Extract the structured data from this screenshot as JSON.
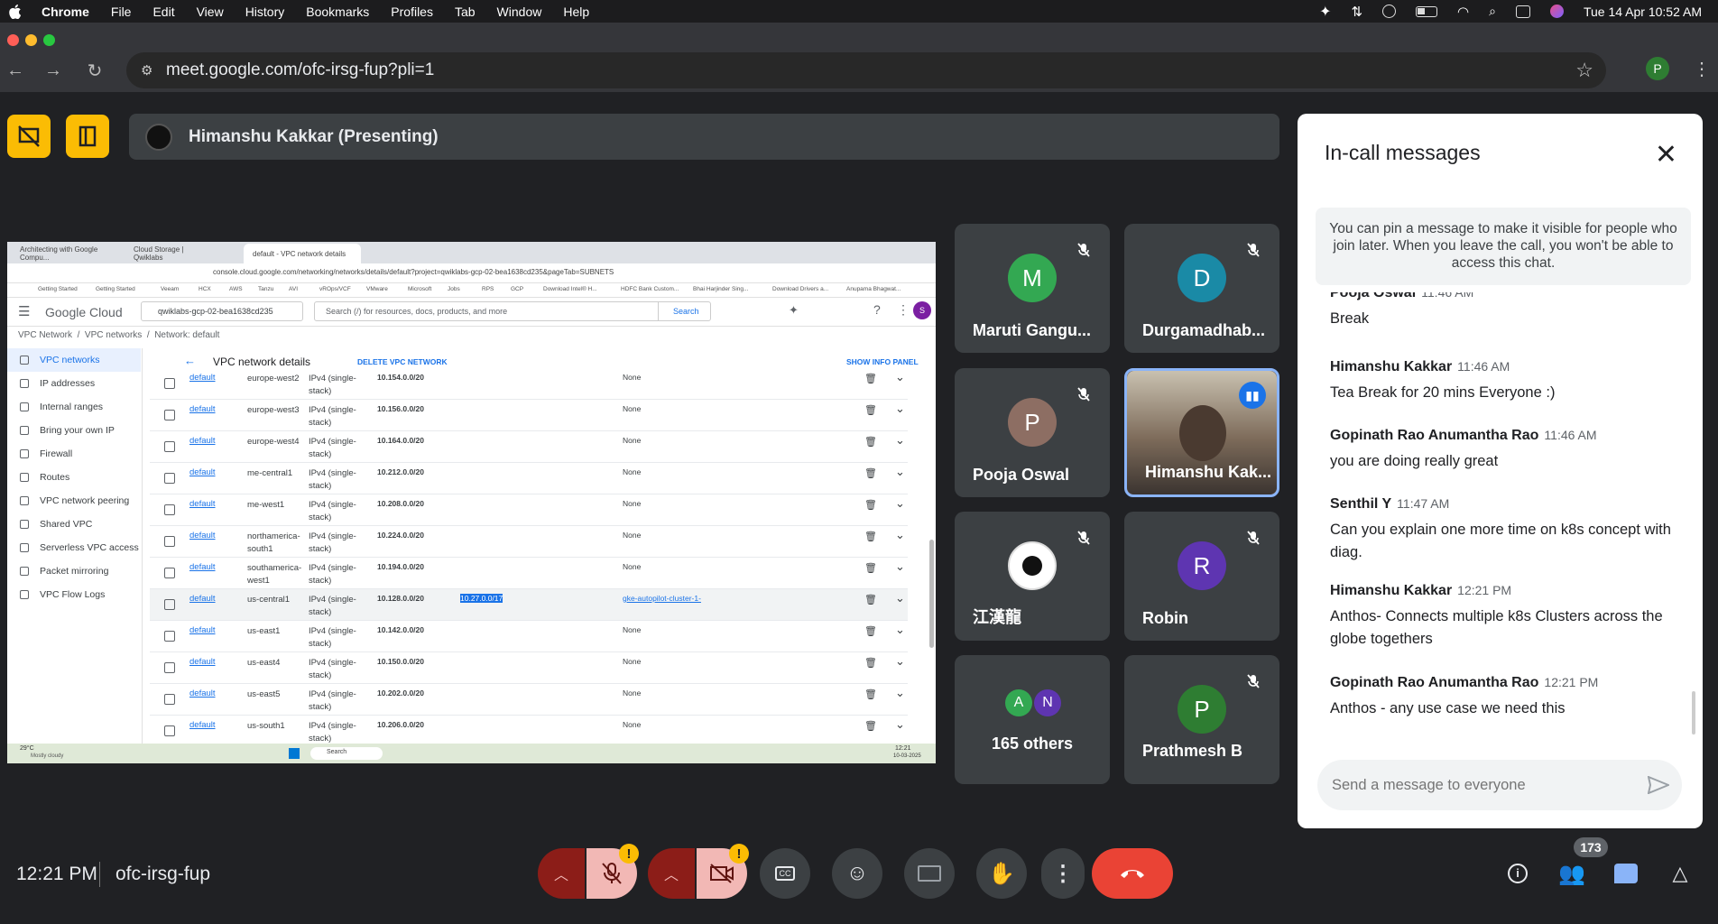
{
  "menubar": {
    "app": "Chrome",
    "items": [
      "File",
      "Edit",
      "View",
      "History",
      "Bookmarks",
      "Profiles",
      "Tab",
      "Window",
      "Help"
    ],
    "datetime": "Tue 14 Apr  10:52 AM"
  },
  "browser": {
    "url": "meet.google.com/ofc-irsg-fup?pli=1",
    "profile_initial": "P"
  },
  "presenting": {
    "label": "Himanshu Kakkar (Presenting)"
  },
  "shared_screen": {
    "tabs": [
      "Architecting with Google Compu...",
      "Cloud Storage | Qwiklabs",
      "default - VPC network details"
    ],
    "url": "console.cloud.google.com/networking/networks/details/default?project=qwiklabs-gcp-02-bea1638cd235&pageTab=SUBNETS",
    "bookmarks": [
      "Getting Started",
      "Getting Started",
      "Veeam",
      "HCX",
      "AWS",
      "Tanzu",
      "AVI",
      "vROps/VCF",
      "VMware",
      "Microsoft",
      "Jobs",
      "RPS",
      "GCP",
      "Download Intel® H...",
      "HDFC Bank Custom...",
      "Bhai Harjinder Sing...",
      "Download Drivers a...",
      "Anupama Bhagwat..."
    ],
    "logo": "Google Cloud",
    "project": "qwiklabs-gcp-02-bea1638cd235",
    "search_placeholder": "Search (/) for resources, docs, products, and more",
    "search_btn": "Search",
    "avatar": "S",
    "breadcrumb": [
      "VPC Network",
      "VPC networks",
      "Network: default"
    ],
    "nav": [
      "VPC networks",
      "IP addresses",
      "Internal ranges",
      "Bring your own IP",
      "Firewall",
      "Routes",
      "VPC network peering",
      "Shared VPC",
      "Serverless VPC access",
      "Packet mirroring",
      "VPC Flow Logs"
    ],
    "page_title": "VPC network details",
    "delete_btn": "DELETE VPC NETWORK",
    "info_btn": "SHOW INFO PANEL",
    "rows": [
      {
        "name": "default",
        "region": "europe-west2",
        "type": "IPv4 (single-stack)",
        "ip": "10.154.0.0/20",
        "ip2": "",
        "gw": "None"
      },
      {
        "name": "default",
        "region": "europe-west3",
        "type": "IPv4 (single-stack)",
        "ip": "10.156.0.0/20",
        "ip2": "",
        "gw": "None"
      },
      {
        "name": "default",
        "region": "europe-west4",
        "type": "IPv4 (single-stack)",
        "ip": "10.164.0.0/20",
        "ip2": "",
        "gw": "None"
      },
      {
        "name": "default",
        "region": "me-central1",
        "type": "IPv4 (single-stack)",
        "ip": "10.212.0.0/20",
        "ip2": "",
        "gw": "None"
      },
      {
        "name": "default",
        "region": "me-west1",
        "type": "IPv4 (single-stack)",
        "ip": "10.208.0.0/20",
        "ip2": "",
        "gw": "None"
      },
      {
        "name": "default",
        "region": "northamerica-south1",
        "type": "IPv4 (single-stack)",
        "ip": "10.224.0.0/20",
        "ip2": "",
        "gw": "None"
      },
      {
        "name": "default",
        "region": "southamerica-west1",
        "type": "IPv4 (single-stack)",
        "ip": "10.194.0.0/20",
        "ip2": "",
        "gw": "None"
      },
      {
        "name": "default",
        "region": "us-central1",
        "type": "IPv4 (single-stack)",
        "ip": "10.128.0.0/20",
        "ip2": "10.27.0.0/17",
        "gw": "gke-autopilot-cluster-1-"
      },
      {
        "name": "default",
        "region": "us-east1",
        "type": "IPv4 (single-stack)",
        "ip": "10.142.0.0/20",
        "ip2": "",
        "gw": "None"
      },
      {
        "name": "default",
        "region": "us-east4",
        "type": "IPv4 (single-stack)",
        "ip": "10.150.0.0/20",
        "ip2": "",
        "gw": "None"
      },
      {
        "name": "default",
        "region": "us-east5",
        "type": "IPv4 (single-stack)",
        "ip": "10.202.0.0/20",
        "ip2": "",
        "gw": "None"
      },
      {
        "name": "default",
        "region": "us-south1",
        "type": "IPv4 (single-stack)",
        "ip": "10.206.0.0/20",
        "ip2": "",
        "gw": "None"
      }
    ],
    "weather": "29°C",
    "weather_sub": "Mostly cloudy",
    "taskbar_search": "Search",
    "clock": "12:21",
    "date": "10-03-2025"
  },
  "participants": [
    {
      "initial": "M",
      "name": "Maruti Gangu...",
      "color": "#33a852",
      "muted": true
    },
    {
      "initial": "D",
      "name": "Durgamadhab...",
      "color": "#1a8aa6",
      "muted": true
    },
    {
      "initial": "P",
      "name": "Pooja Oswal",
      "color": "#8d6e63",
      "muted": true
    },
    {
      "initial": "",
      "name": "Himanshu Kak...",
      "color": "",
      "muted": false
    },
    {
      "initial": "",
      "name": "江漢龍",
      "color": "",
      "muted": true
    },
    {
      "initial": "R",
      "name": "Robin",
      "color": "#5e35b1",
      "muted": true
    },
    {
      "initial": "",
      "name": "165 others",
      "color": "",
      "muted": false
    },
    {
      "initial": "P",
      "name": "Prathmesh B",
      "color": "#2e7d32",
      "muted": true
    }
  ],
  "others_avatars": [
    "A",
    "N"
  ],
  "chat": {
    "title": "In-call messages",
    "pin_note": "You can pin a message to make it visible for people who join later. When you leave the call, you won't be able to access this chat.",
    "messages": [
      {
        "sender": "Pooja Oswal",
        "time": "11:46 AM",
        "text": "Break"
      },
      {
        "sender": "Himanshu Kakkar",
        "time": "11:46 AM",
        "text": "Tea Break for 20 mins Everyone :)"
      },
      {
        "sender": "Gopinath Rao Anumantha Rao",
        "time": "11:46 AM",
        "text": "you are doing really great"
      },
      {
        "sender": "Senthil Y",
        "time": "11:47 AM",
        "text": "Can you explain one more time on k8s concept with diag."
      },
      {
        "sender": "Himanshu Kakkar",
        "time": "12:21 PM",
        "text": "Anthos- Connects multiple k8s Clusters across the globe togethers"
      },
      {
        "sender": "Gopinath Rao Anumantha Rao",
        "time": "12:21 PM",
        "text": "Anthos - any use case we need this"
      }
    ],
    "input_placeholder": "Send a message to everyone"
  },
  "bottom": {
    "time": "12:21 PM",
    "meeting_code": "ofc-irsg-fup",
    "people_count": "173"
  }
}
